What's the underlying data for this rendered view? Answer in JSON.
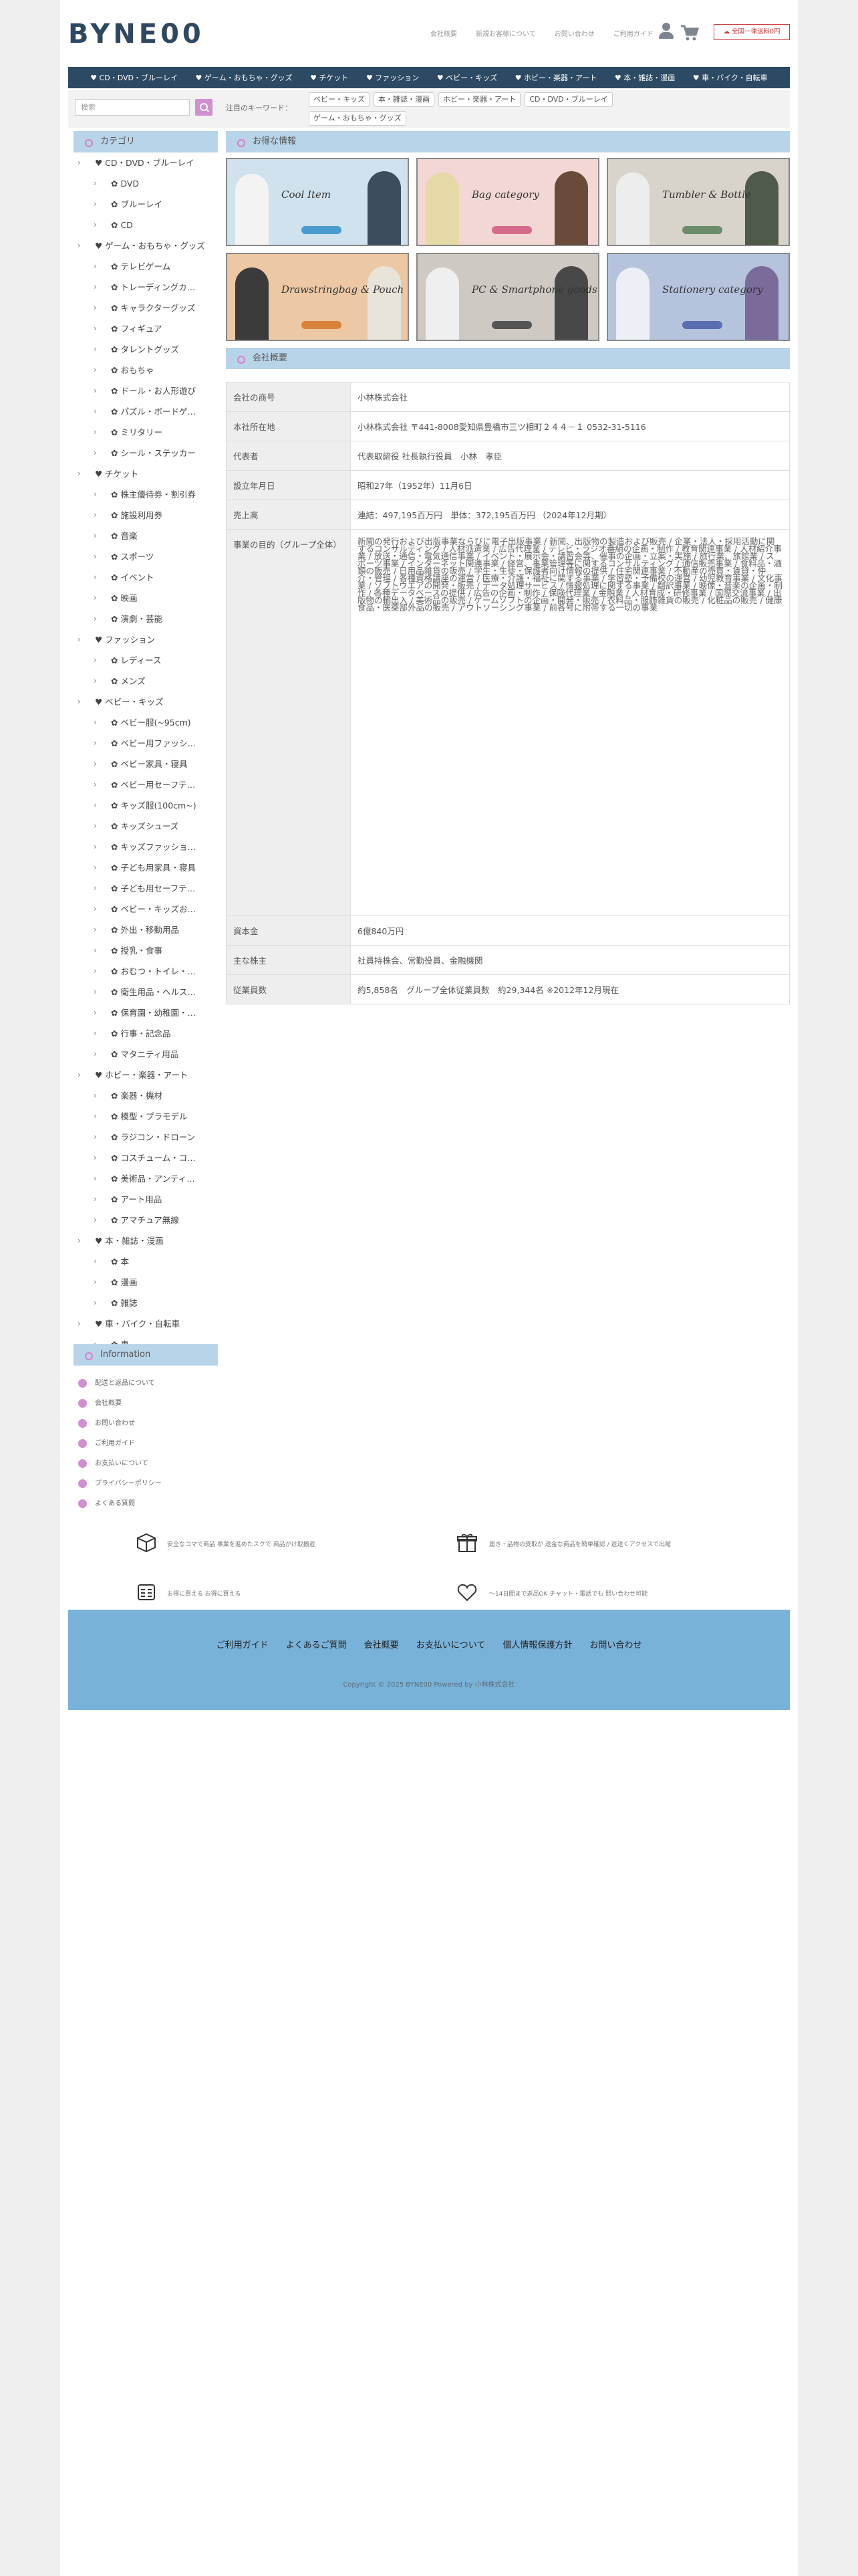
{
  "brand": {
    "logo": "BYNE00"
  },
  "header": {
    "links": [
      "会社概要",
      "新規お客様について",
      "お問い合わせ",
      "ご利用ガイド"
    ],
    "cta": "全国一律送料0円"
  },
  "nav": [
    "CD・DVD・ブルーレイ",
    "ゲーム・おもちゃ・グッズ",
    "チケット",
    "ファッション",
    "ベビー・キッズ",
    "ホビー・楽器・アート",
    "本・雑誌・漫画",
    "車・バイク・自転車"
  ],
  "search": {
    "placeholder": "検索",
    "keyword_label": "注目のキーワード：",
    "keywords": [
      "ベビー・キッズ",
      "本・雑誌・漫画",
      "ホビー・楽器・アート",
      "CD・DVD・ブルーレイ",
      "ゲーム・おもちゃ・グッズ"
    ]
  },
  "sidebar": {
    "title": "カテゴリ",
    "categories": [
      {
        "label": "♥ CD・DVD・ブルーレイ",
        "level": 1
      },
      {
        "label": "✿ DVD",
        "level": 2
      },
      {
        "label": "✿ ブルーレイ",
        "level": 2
      },
      {
        "label": "✿ CD",
        "level": 2
      },
      {
        "label": "♥ ゲーム・おもちゃ・グッズ",
        "level": 1
      },
      {
        "label": "✿ テレビゲーム",
        "level": 2
      },
      {
        "label": "✿ トレーディングカ…",
        "level": 2
      },
      {
        "label": "✿ キャラクターグッズ",
        "level": 2
      },
      {
        "label": "✿ フィギュア",
        "level": 2
      },
      {
        "label": "✿ タレントグッズ",
        "level": 2
      },
      {
        "label": "✿ おもちゃ",
        "level": 2
      },
      {
        "label": "✿ ドール・お人形遊び",
        "level": 2
      },
      {
        "label": "✿ パズル・ボードゲ…",
        "level": 2
      },
      {
        "label": "✿ ミリタリー",
        "level": 2
      },
      {
        "label": "✿ シール・ステッカー",
        "level": 2
      },
      {
        "label": "♥ チケット",
        "level": 1
      },
      {
        "label": "✿ 株主優待券・割引券",
        "level": 2
      },
      {
        "label": "✿ 施設利用券",
        "level": 2
      },
      {
        "label": "✿ 音楽",
        "level": 2
      },
      {
        "label": "✿ スポーツ",
        "level": 2
      },
      {
        "label": "✿ イベント",
        "level": 2
      },
      {
        "label": "✿ 映画",
        "level": 2
      },
      {
        "label": "✿ 演劇・芸能",
        "level": 2
      },
      {
        "label": "♥ ファッション",
        "level": 1
      },
      {
        "label": "✿ レディース",
        "level": 2
      },
      {
        "label": "✿ メンズ",
        "level": 2
      },
      {
        "label": "♥ ベビー・キッズ",
        "level": 1
      },
      {
        "label": "✿ ベビー服(~95cm)",
        "level": 2
      },
      {
        "label": "✿ ベビー用ファッシ…",
        "level": 2
      },
      {
        "label": "✿ ベビー家具・寝具",
        "level": 2
      },
      {
        "label": "✿ ベビー用セーフテ…",
        "level": 2
      },
      {
        "label": "✿ キッズ服(100cm~)",
        "level": 2
      },
      {
        "label": "✿ キッズシューズ",
        "level": 2
      },
      {
        "label": "✿ キッズファッショ…",
        "level": 2
      },
      {
        "label": "✿ 子ども用家具・寝具",
        "level": 2
      },
      {
        "label": "✿ 子ども用セーフテ…",
        "level": 2
      },
      {
        "label": "✿ ベビー・キッズお…",
        "level": 2
      },
      {
        "label": "✿ 外出・移動用品",
        "level": 2
      },
      {
        "label": "✿ 授乳・食事",
        "level": 2
      },
      {
        "label": "✿ おむつ・トイレ・…",
        "level": 2
      },
      {
        "label": "✿ 衛生用品・ヘルス…",
        "level": 2
      },
      {
        "label": "✿ 保育園・幼稚園・…",
        "level": 2
      },
      {
        "label": "✿ 行事・記念品",
        "level": 2
      },
      {
        "label": "✿ マタニティ用品",
        "level": 2
      },
      {
        "label": "♥ ホビー・楽器・アート",
        "level": 1
      },
      {
        "label": "✿ 楽器・機材",
        "level": 2
      },
      {
        "label": "✿ 模型・プラモデル",
        "level": 2
      },
      {
        "label": "✿ ラジコン・ドローン",
        "level": 2
      },
      {
        "label": "✿ コスチューム・コ…",
        "level": 2
      },
      {
        "label": "✿ 美術品・アンティ…",
        "level": 2
      },
      {
        "label": "✿ アート用品",
        "level": 2
      },
      {
        "label": "✿ アマチュア無線",
        "level": 2
      },
      {
        "label": "♥ 本・雑誌・漫画",
        "level": 1
      },
      {
        "label": "✿ 本",
        "level": 2
      },
      {
        "label": "✿ 漫画",
        "level": 2
      },
      {
        "label": "✿ 雑誌",
        "level": 2
      },
      {
        "label": "♥ 車・バイク・自転車",
        "level": 1
      },
      {
        "label": "✿ 車",
        "level": 2
      }
    ]
  },
  "info": {
    "title": "Information",
    "items": [
      "配送と返品について",
      "会社概要",
      "お問い合わせ",
      "ご利用ガイド",
      "お支払いについて",
      "プライバシーポリシー",
      "よくある質問"
    ]
  },
  "main": {
    "deals_title": "お得な情報",
    "company_title": "会社概要",
    "banners": [
      {
        "title": "Cool Item"
      },
      {
        "title": "Bag category"
      },
      {
        "title": "Tumbler & Bottle"
      },
      {
        "title": "Drawstringbag & Pouch"
      },
      {
        "title": "PC & Smartphone goods"
      },
      {
        "title": "Stationery category"
      }
    ]
  },
  "company": [
    {
      "k": "会社の商号",
      "v": "小林株式会社"
    },
    {
      "k": "本社所在地",
      "v": "小林株式会社 〒441-8008愛知県豊橋市三ツ相町２４４－１ 0532-31-5116"
    },
    {
      "k": "代表者",
      "v": "代表取締役 社長執行役員　小林　孝臣"
    },
    {
      "k": "設立年月日",
      "v": "昭和27年（1952年）11月6日"
    },
    {
      "k": "売上高",
      "v": "連結：497,195百万円　単体：372,195百万円 （2024年12月期）"
    },
    {
      "k": "事業の目的（グループ全体）",
      "v": "新聞の発行および出版事業ならびに電子出版事業 / 新聞、出版物の製造および販売 / 企業・法人・採用活動に関するコンサルティング / 人材派遣業 / 広告代理業 / テレビ・ラジオ番組の企画・制作 / 教育関連事業 / 人材紹介事業 / 放送・通信・電気通信事業 / イベント・展示会・講習会等、催事の企画・立案・実施 / 旅行業、旅館業 / スポーツ事業 / インターネット関連事業 / 経営、事業管理等に関するコンサルティング / 通信販売事業 / 食料品・酒類の販売 / 日用品雑貨の販売 / 学生・生徒・保護者向け情報の提供 / 住宅関連事業 / 不動産の売買・賃貸・仲介・管理 / 各種資格講座の運営 / 医療・介護・福祉に関する事業 / 学習塾・予備校の運営 / 幼児教育事業 / 文化事業 / ソフトウエアの開発・販売 / データ処理サービス / 情報処理に関する事業 / 翻訳事業 / 映像・音楽の企画・制作 / 各種データベースの提供 / 広告の企画・制作 / 保険代理業 / 金融業 / 人材育成・研修事業 / 国際交流事業 / 出版物の輸出入 / 美術品の販売 / ゲームソフトの企画・開発・販売 / 衣料品・服飾雑貨の販売 / 化粧品の販売 / 健康食品・医薬部外品の販売 / アウトソーシング事業 / 前各号に附帯する一切の事業"
    },
    {
      "k": "資本金",
      "v": "6億840万円"
    },
    {
      "k": "主な株主",
      "v": "社員持株会、常勤役員、金融機関"
    },
    {
      "k": "従業員数",
      "v": "約5,858名　グループ全体従業員数　約29,344名 ※2012年12月現在"
    }
  ],
  "features": [
    "安全なコマで商品 事業を進めたスクで 商品がけ取揃返",
    "届き・品物の受取が 送金な商品を簡単確認 / 返送くアクセスで出館",
    "お得に買える お得に買える",
    "〜14日間まで返品OK チャット・電話でも 問い合わせ可能"
  ],
  "footer": {
    "links": [
      "ご利用ガイド",
      "よくあるご質問",
      "会社概要",
      "お支払いについて",
      "個人情報保護方針",
      "お問い合わせ"
    ],
    "copyright": "Copyright © 2025 BYNE00 Powered by 小林株式会社"
  }
}
